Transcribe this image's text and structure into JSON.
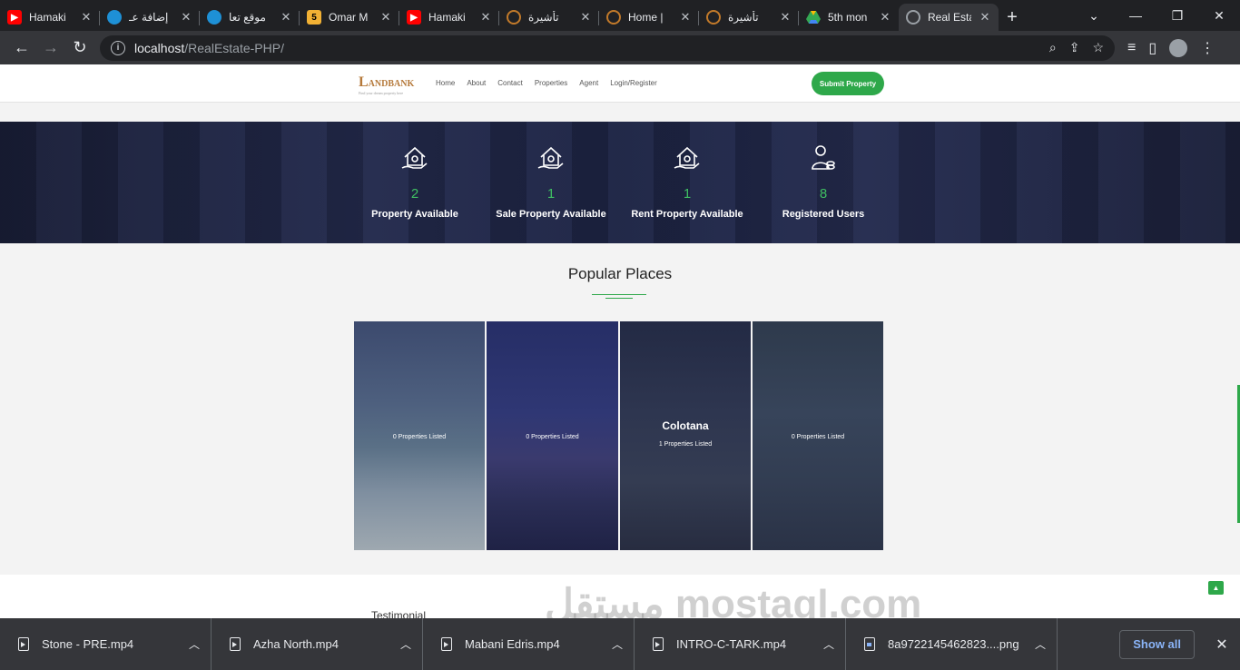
{
  "tabs": [
    {
      "title": "Hamaki",
      "icon": "youtube-icon",
      "color": "#ff0000"
    },
    {
      "title": "إضافة عـ",
      "icon": "circle-icon",
      "color": "#1e90d6"
    },
    {
      "title": "موقع تعا",
      "icon": "circle-icon",
      "color": "#1e90d6"
    },
    {
      "title": "Omar M",
      "icon": "five-icon",
      "color": "#f2b134"
    },
    {
      "title": "Hamaki",
      "icon": "youtube-icon",
      "color": "#ff0000"
    },
    {
      "title": "تأشيرة",
      "icon": "ring-icon",
      "color": "#c27a2a"
    },
    {
      "title": "Home |",
      "icon": "ring-icon",
      "color": "#c27a2a"
    },
    {
      "title": "تأشيرة",
      "icon": "ring-icon",
      "color": "#c27a2a"
    },
    {
      "title": "5th mon",
      "icon": "drive-icon",
      "color": "#34a853"
    },
    {
      "title": "Real Esta",
      "icon": "globe-icon",
      "color": "#9aa0a6"
    }
  ],
  "address": {
    "host": "localhost",
    "path": "/RealEstate-PHP/"
  },
  "site": {
    "logo_initial": "L",
    "logo_text": "ANDBANK",
    "logo_tagline": "Find your dream property here",
    "nav": [
      "Home",
      "About",
      "Contact",
      "Properties",
      "Agent",
      "Login/Register"
    ],
    "submit_label": "Submit Property"
  },
  "stats": [
    {
      "value": "2",
      "label": "Property Available",
      "icon": "house-hand-icon"
    },
    {
      "value": "1",
      "label": "Sale Property Available",
      "icon": "house-hand-icon"
    },
    {
      "value": "1",
      "label": "Rent Property Available",
      "icon": "house-hand-icon"
    },
    {
      "value": "8",
      "label": "Registered Users",
      "icon": "user-group-icon"
    }
  ],
  "popular": {
    "title": "Popular Places",
    "cards": [
      {
        "name": "",
        "count": "0 Properties Listed"
      },
      {
        "name": "",
        "count": "0 Properties Listed"
      },
      {
        "name": "Colotana",
        "count": "1 Properties Listed"
      },
      {
        "name": "",
        "count": "0 Properties Listed"
      }
    ]
  },
  "testimonial_label": "Testimonial",
  "watermark": "مستقل mostaql.com",
  "downloads": [
    {
      "name": "Stone - PRE.mp4",
      "type": "video"
    },
    {
      "name": "Azha North.mp4",
      "type": "video"
    },
    {
      "name": "Mabani Edris.mp4",
      "type": "video"
    },
    {
      "name": "INTRO-C-TARK.mp4",
      "type": "video"
    },
    {
      "name": "8a9722145462823....png",
      "type": "image"
    }
  ],
  "show_all_label": "Show all",
  "colors": {
    "accent": "#2ea84a",
    "stats_bg": "#1e2545",
    "chrome_bg": "#35363a"
  }
}
